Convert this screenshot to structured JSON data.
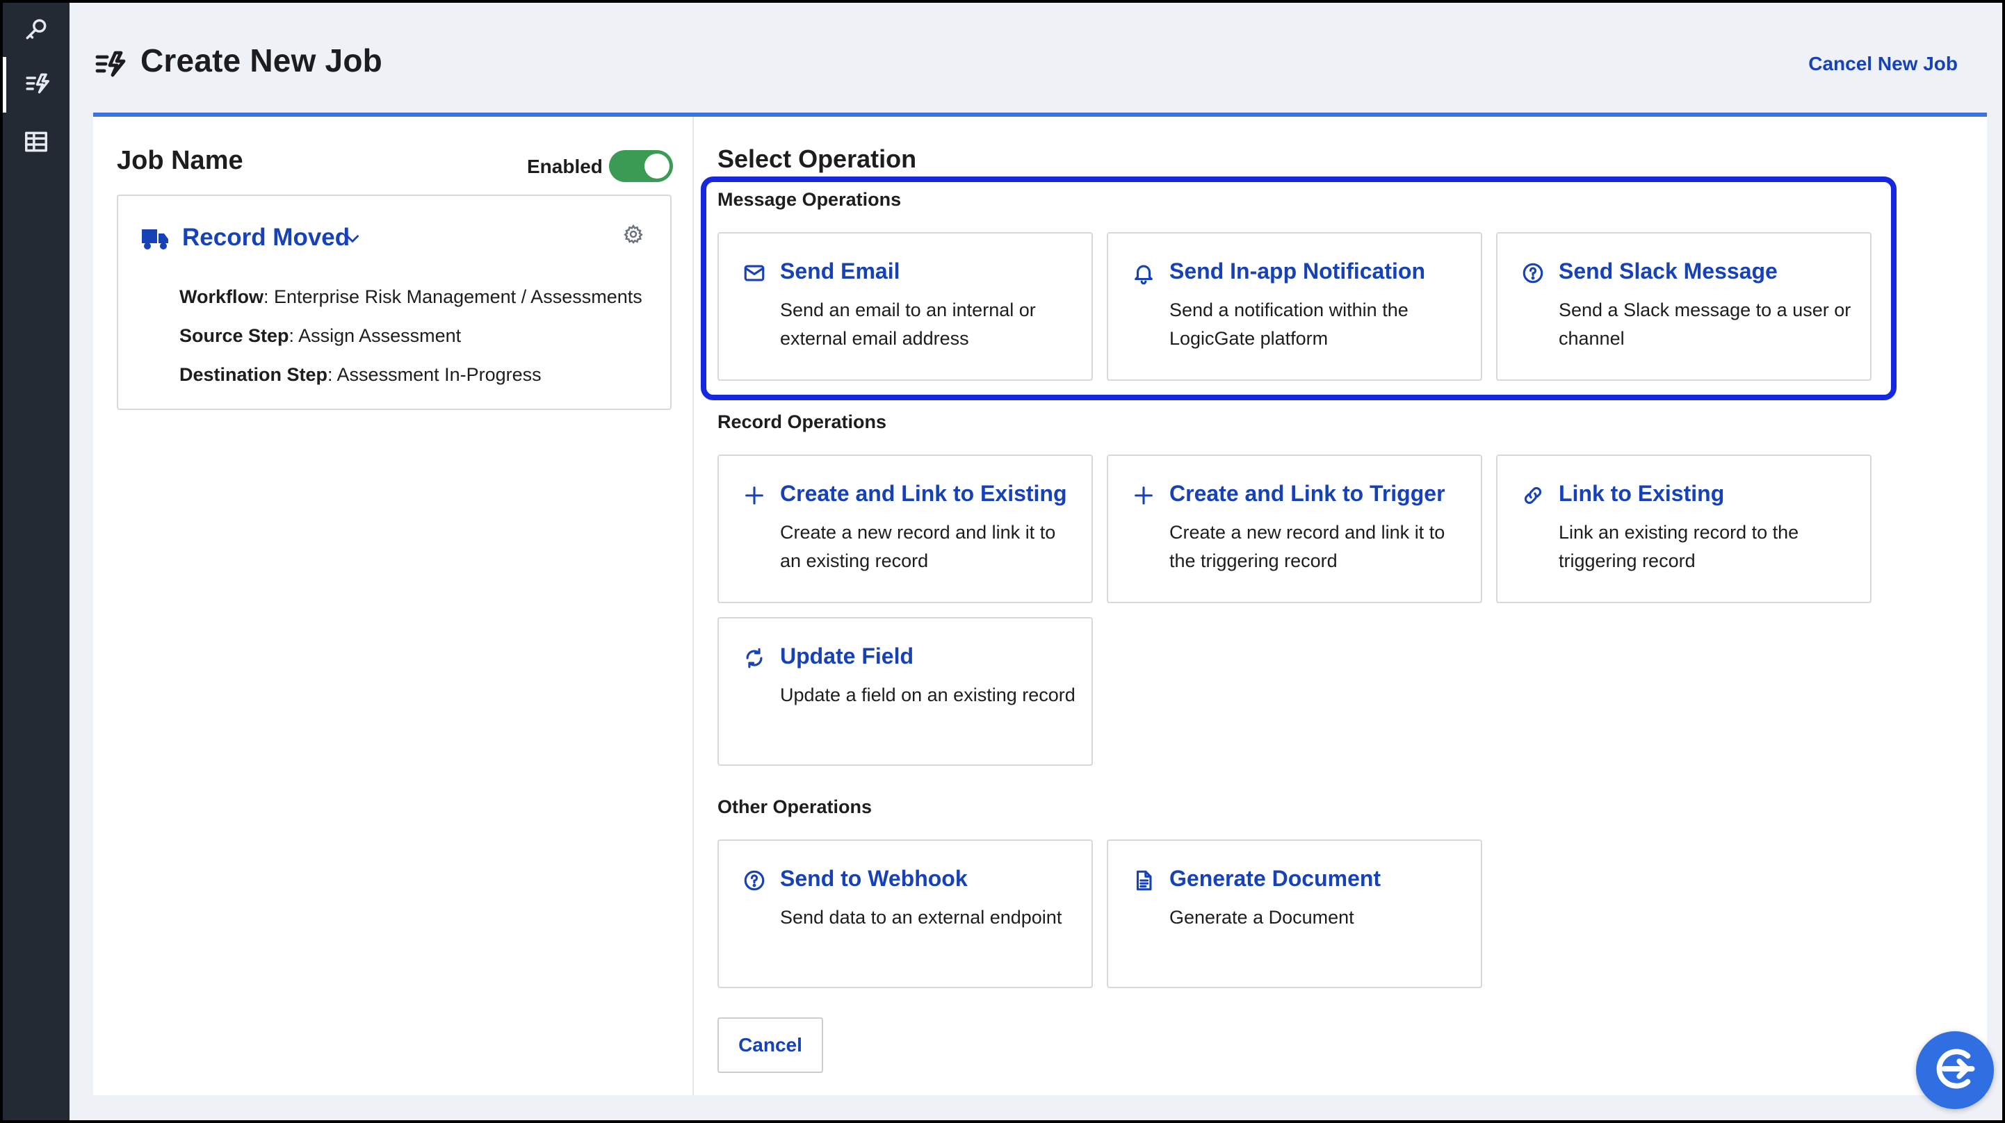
{
  "header": {
    "title": "Create New Job",
    "cancel_link": "Cancel New Job"
  },
  "rail": {
    "items": [
      {
        "icon": "key-icon"
      },
      {
        "icon": "jobs-icon",
        "active": true
      },
      {
        "icon": "table-icon"
      }
    ]
  },
  "job": {
    "label": "Job Name",
    "enabled_label": "Enabled",
    "enabled": true,
    "trigger": {
      "name": "Record Moved",
      "workflow_label": "Workflow",
      "workflow_value": "Enterprise Risk Management  / Assessments",
      "source_label": "Source Step",
      "source_value": "Assign Assessment",
      "destination_label": "Destination Step",
      "destination_value": "Assessment In-Progress"
    }
  },
  "operations": {
    "title": "Select Operation",
    "message": {
      "label": "Message Operations",
      "cards": [
        {
          "icon": "envelope-icon",
          "title": "Send Email",
          "desc": "Send an email to an internal or external email address"
        },
        {
          "icon": "bell-icon",
          "title": "Send In-app Notification",
          "desc": "Send a notification within the LogicGate platform"
        },
        {
          "icon": "question-circle-icon",
          "title": "Send Slack Message",
          "desc": "Send a Slack message to a user or channel"
        }
      ]
    },
    "record": {
      "label": "Record Operations",
      "cards": [
        {
          "icon": "plus-icon",
          "title": "Create and Link to Existing",
          "desc": "Create a new record and link it to an existing record"
        },
        {
          "icon": "plus-icon",
          "title": "Create and Link to Trigger",
          "desc": "Create a new record and link it to the triggering record"
        },
        {
          "icon": "link-icon",
          "title": "Link to Existing",
          "desc": "Link an existing record to the triggering record"
        },
        {
          "icon": "refresh-icon",
          "title": "Update Field",
          "desc": "Update a field on an existing record"
        }
      ]
    },
    "other": {
      "label": "Other Operations",
      "cards": [
        {
          "icon": "question-circle-icon",
          "title": "Send to Webhook",
          "desc": "Send data to an external endpoint"
        },
        {
          "icon": "document-icon",
          "title": "Generate Document",
          "desc": "Generate a Document"
        }
      ]
    },
    "cancel_label": "Cancel"
  },
  "colors": {
    "accent": "#1742b7",
    "highlight": "#1528e0",
    "toggle_on": "#3b9b54",
    "rail": "#232a33",
    "panel_top_border": "#3a73e0"
  }
}
